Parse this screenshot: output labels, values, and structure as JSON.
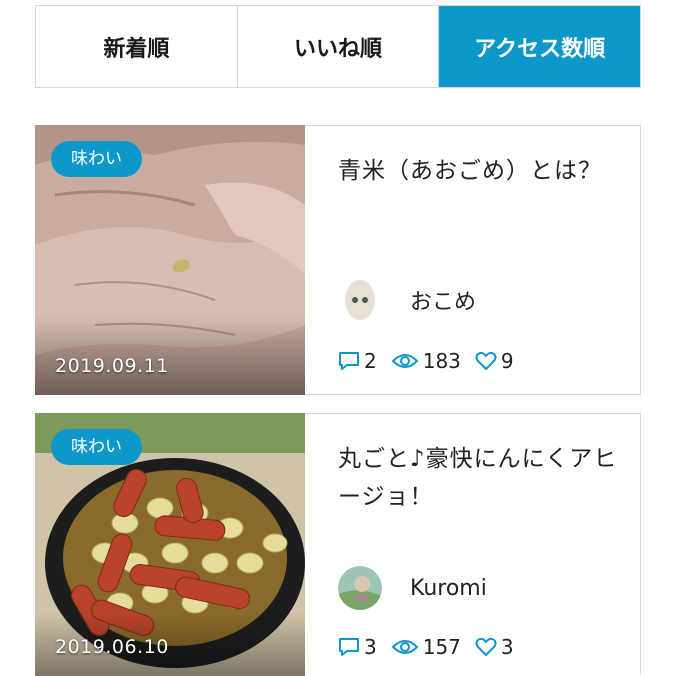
{
  "tabs": [
    {
      "label": "新着順",
      "active": false
    },
    {
      "label": "いいね順",
      "active": false
    },
    {
      "label": "アクセス数順",
      "active": true
    }
  ],
  "posts": [
    {
      "category": "味わい",
      "date": "2019.09.11",
      "title": "青米（あおごめ）とは？",
      "author": "おこめ",
      "comments": "2",
      "views": "183",
      "likes": "9"
    },
    {
      "category": "味わい",
      "date": "2019.06.10",
      "title": "丸ごと♪豪快にんにくアヒージョ！",
      "author": "Kuromi",
      "comments": "3",
      "views": "157",
      "likes": "3"
    }
  ],
  "colors": {
    "accent": "#0e97c9",
    "border": "#d8d8d8"
  }
}
